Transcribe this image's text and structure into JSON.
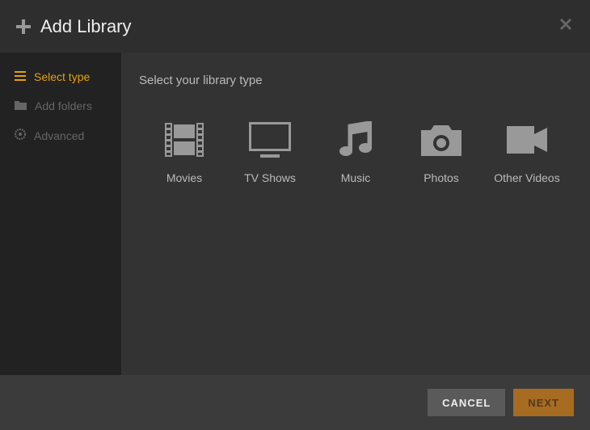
{
  "header": {
    "title": "Add Library"
  },
  "sidebar": {
    "items": [
      {
        "label": "Select type",
        "active": true
      },
      {
        "label": "Add folders",
        "active": false
      },
      {
        "label": "Advanced",
        "active": false
      }
    ]
  },
  "content": {
    "heading": "Select your library type",
    "types": [
      {
        "label": "Movies"
      },
      {
        "label": "TV Shows"
      },
      {
        "label": "Music"
      },
      {
        "label": "Photos"
      },
      {
        "label": "Other Videos"
      }
    ]
  },
  "footer": {
    "cancel": "CANCEL",
    "next": "NEXT"
  }
}
